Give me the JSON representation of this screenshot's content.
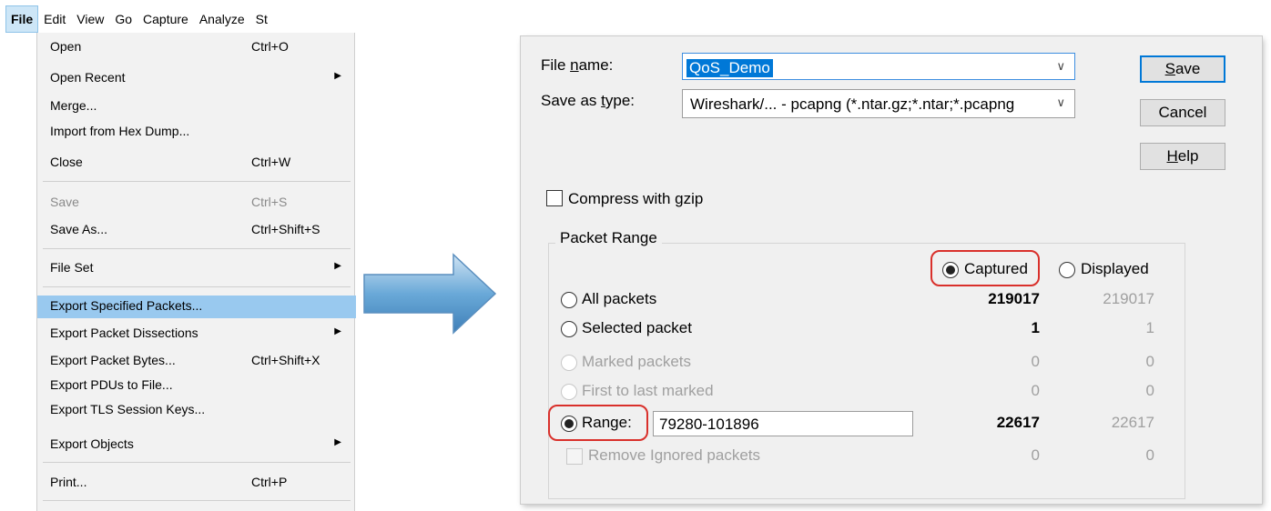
{
  "menubar": {
    "items": [
      "File",
      "Edit",
      "View",
      "Go",
      "Capture",
      "Analyze",
      "St"
    ]
  },
  "file_menu": {
    "items": [
      {
        "label": "Open",
        "shortcut": "Ctrl+O"
      },
      {
        "label": "Open Recent",
        "submenu": true
      },
      {
        "label": "Merge..."
      },
      {
        "label": "Import from Hex Dump..."
      },
      {
        "label": "Close",
        "shortcut": "Ctrl+W"
      },
      {
        "label": "Save",
        "shortcut": "Ctrl+S",
        "disabled": true
      },
      {
        "label": "Save As...",
        "shortcut": "Ctrl+Shift+S"
      },
      {
        "label": "File Set",
        "submenu": true
      },
      {
        "label": "Export Specified Packets...",
        "highlighted": true
      },
      {
        "label": "Export Packet Dissections",
        "submenu": true
      },
      {
        "label": "Export Packet Bytes...",
        "shortcut": "Ctrl+Shift+X"
      },
      {
        "label": "Export PDUs to File..."
      },
      {
        "label": "Export TLS Session Keys..."
      },
      {
        "label": "Export Objects",
        "submenu": true
      },
      {
        "label": "Print...",
        "shortcut": "Ctrl+P"
      }
    ],
    "arrow_glyph": "▶"
  },
  "dialog": {
    "file_name_label_pre": "File ",
    "file_name_label_u": "n",
    "file_name_label_post": "ame:",
    "file_name_value": "QoS_Demo",
    "save_type_label_pre": "Save as ",
    "save_type_label_u": "t",
    "save_type_label_post": "ype:",
    "save_type_value": "Wireshark/... - pcapng (*.ntar.gz;*.ntar;*.pcapng",
    "chevron": "∨",
    "buttons": {
      "save_u": "S",
      "save_rest": "ave",
      "cancel": "Cancel",
      "help_u": "H",
      "help_rest": "elp"
    },
    "compress_label": "Compress with gzip",
    "packet_range": {
      "title": "Packet Range",
      "captured_label": "Captured",
      "displayed_label": "Displayed",
      "rows": [
        {
          "label": "All packets",
          "captured": "219017",
          "displayed": "219017"
        },
        {
          "label": "Selected packet",
          "captured": "1",
          "displayed": "1"
        },
        {
          "label": "Marked packets",
          "captured": "0",
          "displayed": "0"
        },
        {
          "label": "First to last marked",
          "captured": "0",
          "displayed": "0"
        },
        {
          "label": "Range:",
          "captured": "22617",
          "displayed": "22617"
        },
        {
          "label": "Remove Ignored packets",
          "captured": "0",
          "displayed": "0"
        }
      ],
      "range_value": "79280-101896"
    }
  },
  "colors": {
    "highlight": "#99c9ef",
    "annotation_red": "#d9302b",
    "arrow_blue": "#5b9fd3"
  }
}
